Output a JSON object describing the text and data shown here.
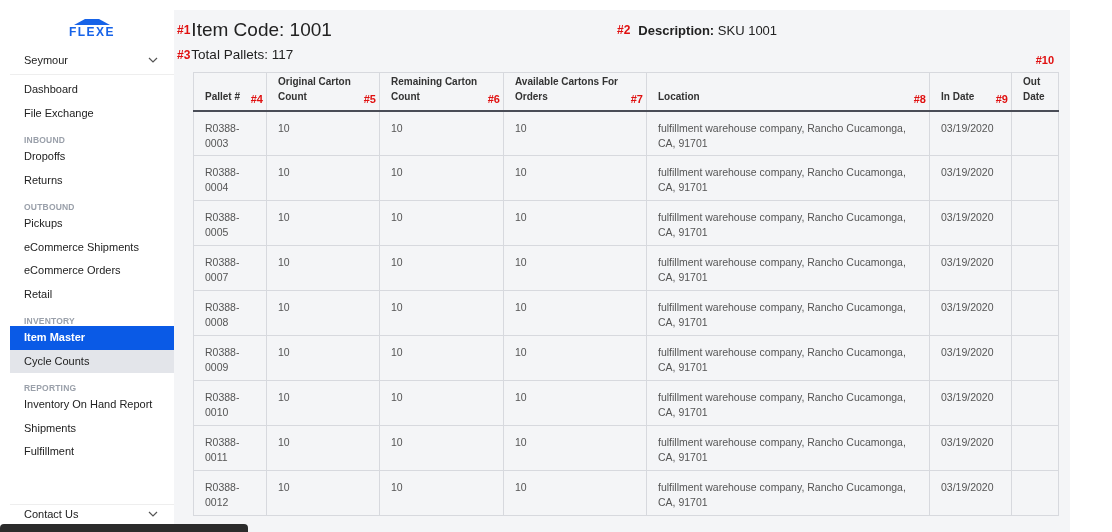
{
  "sidebar": {
    "logo": "FLEXE",
    "account": "Seymour",
    "sections": [
      {
        "items": [
          {
            "label": "Dashboard",
            "selected": false,
            "highlighted": false
          },
          {
            "label": "File Exchange",
            "selected": false,
            "highlighted": false
          }
        ]
      },
      {
        "heading": "INBOUND",
        "items": [
          {
            "label": "Dropoffs",
            "selected": false,
            "highlighted": false
          },
          {
            "label": "Returns",
            "selected": false,
            "highlighted": false
          }
        ]
      },
      {
        "heading": "OUTBOUND",
        "items": [
          {
            "label": "Pickups",
            "selected": false,
            "highlighted": false
          },
          {
            "label": "eCommerce Shipments",
            "selected": false,
            "highlighted": false
          },
          {
            "label": "eCommerce Orders",
            "selected": false,
            "highlighted": false
          },
          {
            "label": "Retail",
            "selected": false,
            "highlighted": false
          }
        ]
      },
      {
        "heading": "INVENTORY",
        "items": [
          {
            "label": "Item Master",
            "selected": true,
            "highlighted": false
          },
          {
            "label": "Cycle Counts",
            "selected": false,
            "highlighted": true
          }
        ]
      },
      {
        "heading": "REPORTING",
        "items": [
          {
            "label": "Inventory On Hand Report",
            "selected": false,
            "highlighted": false
          },
          {
            "label": "Shipments",
            "selected": false,
            "highlighted": false
          },
          {
            "label": "Fulfillment",
            "selected": false,
            "highlighted": false
          }
        ]
      }
    ],
    "footer": "Contact Us"
  },
  "header": {
    "item_code": {
      "marker": "#1",
      "text": "Item Code: 1001"
    },
    "description": {
      "marker": "#2",
      "label": "Description:",
      "value": "SKU 1001"
    },
    "total_pallets": {
      "marker": "#3",
      "text": "Total Pallets: 117"
    }
  },
  "table": {
    "columns": [
      {
        "label": "Pallet #",
        "marker": "#4"
      },
      {
        "label": "Original Carton Count",
        "marker": "#5"
      },
      {
        "label": "Remaining Carton Count",
        "marker": "#6"
      },
      {
        "label": "Available Cartons For Orders",
        "marker": "#7"
      },
      {
        "label": "Location",
        "marker": "#8"
      },
      {
        "label": "In Date",
        "marker": "#9"
      },
      {
        "label": "Out Date",
        "marker": "#10"
      }
    ],
    "rows": [
      [
        "R0388-0003",
        "10",
        "10",
        "10",
        "fulfillment warehouse company, Rancho Cucamonga, CA, 91701",
        "03/19/2020",
        ""
      ],
      [
        "R0388-0004",
        "10",
        "10",
        "10",
        "fulfillment warehouse company, Rancho Cucamonga, CA, 91701",
        "03/19/2020",
        ""
      ],
      [
        "R0388-0005",
        "10",
        "10",
        "10",
        "fulfillment warehouse company, Rancho Cucamonga, CA, 91701",
        "03/19/2020",
        ""
      ],
      [
        "R0388-0007",
        "10",
        "10",
        "10",
        "fulfillment warehouse company, Rancho Cucamonga, CA, 91701",
        "03/19/2020",
        ""
      ],
      [
        "R0388-0008",
        "10",
        "10",
        "10",
        "fulfillment warehouse company, Rancho Cucamonga, CA, 91701",
        "03/19/2020",
        ""
      ],
      [
        "R0388-0009",
        "10",
        "10",
        "10",
        "fulfillment warehouse company, Rancho Cucamonga, CA, 91701",
        "03/19/2020",
        ""
      ],
      [
        "R0388-0010",
        "10",
        "10",
        "10",
        "fulfillment warehouse company, Rancho Cucamonga, CA, 91701",
        "03/19/2020",
        ""
      ],
      [
        "R0388-0011",
        "10",
        "10",
        "10",
        "fulfillment warehouse company, Rancho Cucamonga, CA, 91701",
        "03/19/2020",
        ""
      ],
      [
        "R0388-0012",
        "10",
        "10",
        "10",
        "fulfillment warehouse company, Rancho Cucamonga, CA, 91701",
        "03/19/2020",
        ""
      ]
    ]
  }
}
